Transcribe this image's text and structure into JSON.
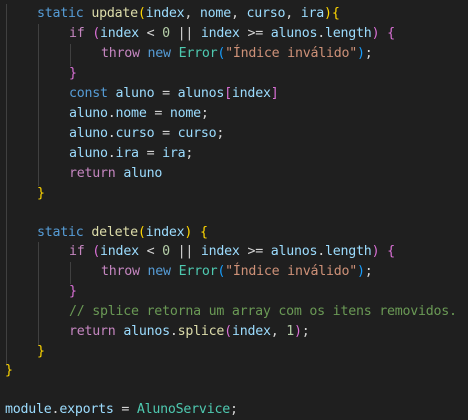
{
  "code": {
    "l1": {
      "kw": "static",
      "fn": "update",
      "p1": "(",
      "a1": "index",
      "c1": ", ",
      "a2": "nome",
      "c2": ", ",
      "a3": "curso",
      "c3": ", ",
      "a4": "ira",
      "p2": ")",
      "b": "{"
    },
    "l2": {
      "kw": "if",
      "p1": "(",
      "v1": "index",
      "op1": " < ",
      "n1": "0",
      "op2": " || ",
      "v2": "index",
      "op3": " >= ",
      "v3": "alunos",
      "dot": ".",
      "v4": "length",
      "p2": ")",
      "b": "{"
    },
    "l3": {
      "kw1": "throw",
      "kw2": "new",
      "cls": "Error",
      "p1": "(",
      "s": "\"Índice inválido\"",
      "p2": ")",
      "semi": ";"
    },
    "l4": {
      "b": "}"
    },
    "l5": {
      "kw": "const",
      "v1": "aluno",
      "op": " = ",
      "v2": "alunos",
      "b1": "[",
      "v3": "index",
      "b2": "]"
    },
    "l6": {
      "v1": "aluno",
      "dot": ".",
      "v2": "nome",
      "op": " = ",
      "v3": "nome",
      "semi": ";"
    },
    "l7": {
      "v1": "aluno",
      "dot": ".",
      "v2": "curso",
      "op": " = ",
      "v3": "curso",
      "semi": ";"
    },
    "l8": {
      "v1": "aluno",
      "dot": ".",
      "v2": "ira",
      "op": " = ",
      "v3": "ira",
      "semi": ";"
    },
    "l9": {
      "kw": "return",
      "v": "aluno"
    },
    "l10": {
      "b": "}"
    },
    "l12": {
      "kw": "static",
      "fn": "delete",
      "p1": "(",
      "a1": "index",
      "p2": ")",
      "b": "{"
    },
    "l13": {
      "kw": "if",
      "p1": "(",
      "v1": "index",
      "op1": " < ",
      "n1": "0",
      "op2": " || ",
      "v2": "index",
      "op3": " >= ",
      "v3": "alunos",
      "dot": ".",
      "v4": "length",
      "p2": ")",
      "b": "{"
    },
    "l14": {
      "kw1": "throw",
      "kw2": "new",
      "cls": "Error",
      "p1": "(",
      "s": "\"Índice inválido\"",
      "p2": ")",
      "semi": ";"
    },
    "l15": {
      "b": "}"
    },
    "l16": {
      "cmt": "// splice retorna um array com os itens removidos."
    },
    "l17": {
      "kw": "return",
      "v1": "alunos",
      "dot": ".",
      "fn": "splice",
      "p1": "(",
      "v2": "index",
      "c": ", ",
      "n": "1",
      "p2": ")",
      "semi": ";"
    },
    "l18": {
      "b": "}"
    },
    "l19": {
      "b": "}"
    },
    "l21": {
      "v1": "module",
      "dot": ".",
      "v2": "exports",
      "op": " = ",
      "cls": "AlunoService",
      "semi": ";"
    }
  }
}
